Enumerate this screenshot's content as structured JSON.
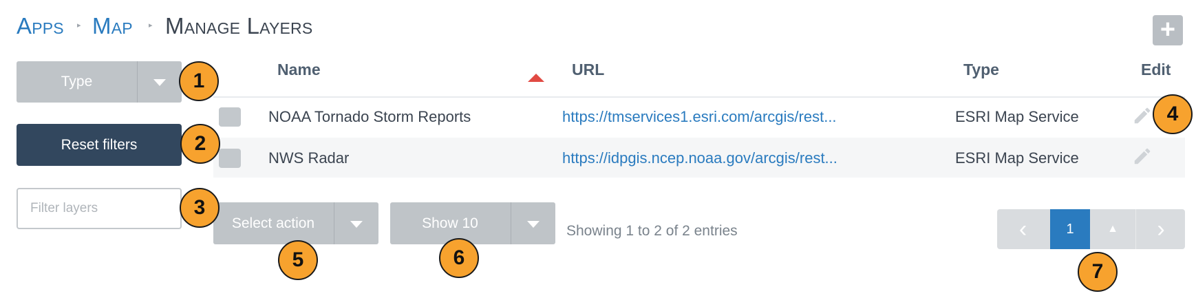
{
  "breadcrumb": {
    "items": [
      "Apps",
      "Map"
    ],
    "current": "Manage Layers",
    "separator": "▸"
  },
  "add_button": {
    "icon": "plus-icon",
    "label": "+"
  },
  "filters": {
    "type_label": "Type",
    "reset_label": "Reset filters",
    "filter_placeholder": "Filter layers",
    "filter_value": ""
  },
  "table": {
    "columns": [
      "Name",
      "URL",
      "Type",
      "Edit"
    ],
    "sort": {
      "column": "Name",
      "direction": "ascending",
      "indicator_color": "#e14a43"
    },
    "rows": [
      {
        "name": "NOAA Tornado Storm Reports",
        "url": "https://tmservices1.esri.com/arcgis/rest...",
        "type": "ESRI Map Service",
        "edit_icon": "pencil-icon"
      },
      {
        "name": "NWS Radar",
        "url": "https://idpgis.ncep.noaa.gov/arcgis/rest...",
        "type": "ESRI Map Service",
        "edit_icon": "pencil-icon"
      }
    ]
  },
  "controls": {
    "select_action_label": "Select action",
    "show_label": "Show 10",
    "entries_info": "Showing 1 to 2 of 2 entries"
  },
  "pagination": {
    "prev": "‹",
    "current_page": "1",
    "up": "▲",
    "next": "›"
  },
  "callouts": [
    "1",
    "2",
    "3",
    "4",
    "5",
    "6",
    "7"
  ],
  "colors": {
    "link": "#2a7bbf",
    "primary_dark": "#32475e",
    "button_grey": "#bfc4c8",
    "callout": "#f7a22e"
  }
}
